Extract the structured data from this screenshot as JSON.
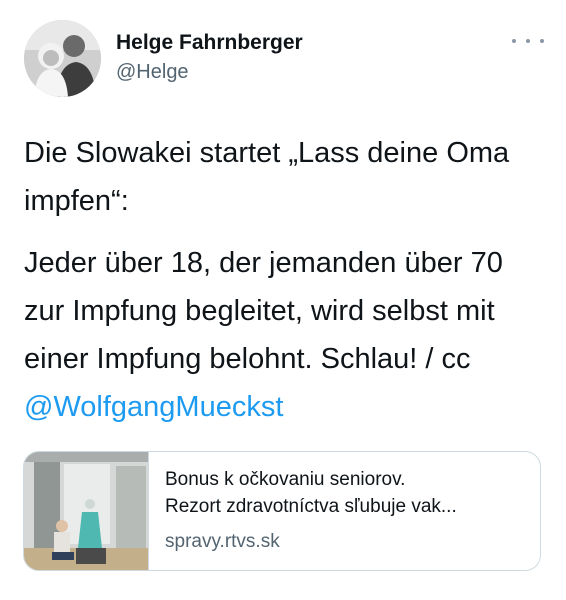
{
  "author": {
    "name": "Helge Fahrnberger",
    "handle": "@Helge"
  },
  "menu_icon": "more-dots-icon",
  "tweet": {
    "paragraph1": "Die Slowakei startet „Lass deine Oma impfen“:",
    "paragraph2": "Jeder über 18, der jemanden über 70 zur Impfung begleitet, wird selbst mit einer Impfung belohnt. Schlau! / cc",
    "mention": "@WolfgangMueckst"
  },
  "link_card": {
    "title_line1": "Bonus k očkovaniu seniorov.",
    "title_line2": "Rezort zdravotníctva sľubuje vak...",
    "domain": "spravy.rtvs.sk"
  },
  "colors": {
    "link": "#1d9bf0",
    "secondary_text": "#536471",
    "border": "#cfd9de"
  }
}
